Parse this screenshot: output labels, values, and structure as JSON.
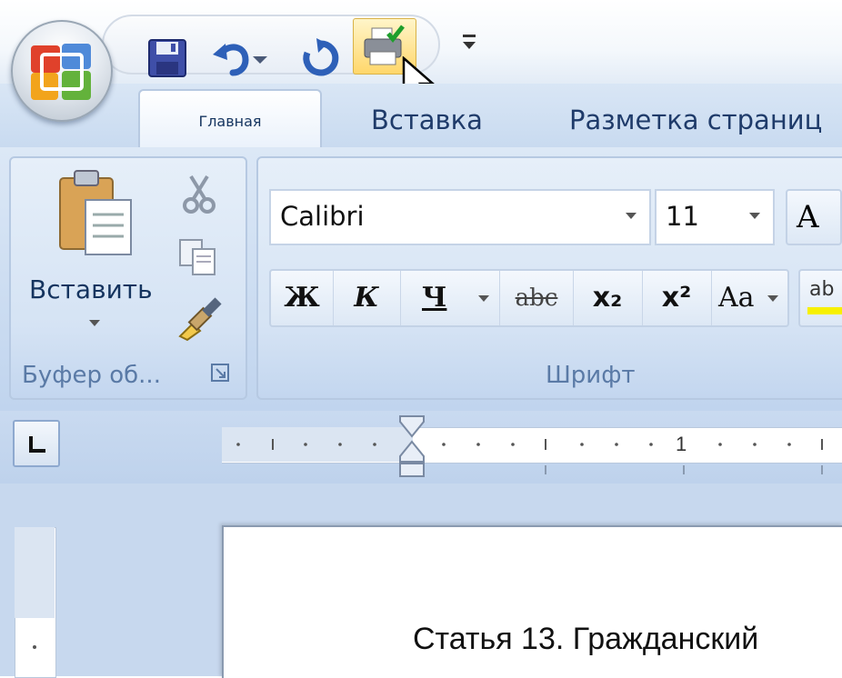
{
  "quick_access": {
    "buttons": [
      "save-icon",
      "undo-icon",
      "dropdown-arrow-icon",
      "redo-icon",
      "quick-print-icon"
    ],
    "customize_icon": "customize-qat-icon"
  },
  "tabs": [
    {
      "label": "Главная",
      "active": true
    },
    {
      "label": "Вставка",
      "active": false
    },
    {
      "label": "Разметка страниц",
      "active": false
    }
  ],
  "clipboard": {
    "paste_label": "Вставить",
    "group_label": "Буфер об...",
    "icons": [
      "paste-icon",
      "cut-icon",
      "copy-icon",
      "format-painter-icon",
      "dialog-launcher-icon"
    ]
  },
  "font": {
    "family_value": "Calibri",
    "size_value": "11",
    "grow_label": "A",
    "bold_label": "Ж",
    "italic_label": "К",
    "underline_label": "Ч",
    "strike_label": "abc",
    "subscript_label": "x₂",
    "superscript_label": "x²",
    "case_label": "Aa",
    "highlight_label": "ab",
    "group_label": "Шрифт"
  },
  "ruler": {
    "number_label": "1",
    "tab_selector_icon": "left-tab-icon"
  },
  "document": {
    "text": "Статья 13. Гражданский"
  },
  "colors": {
    "ribbon": "#cbdcf1",
    "tab_text": "#1f3b6a",
    "group_label": "#5a7aa6",
    "workspace": "#c7d8ee"
  }
}
